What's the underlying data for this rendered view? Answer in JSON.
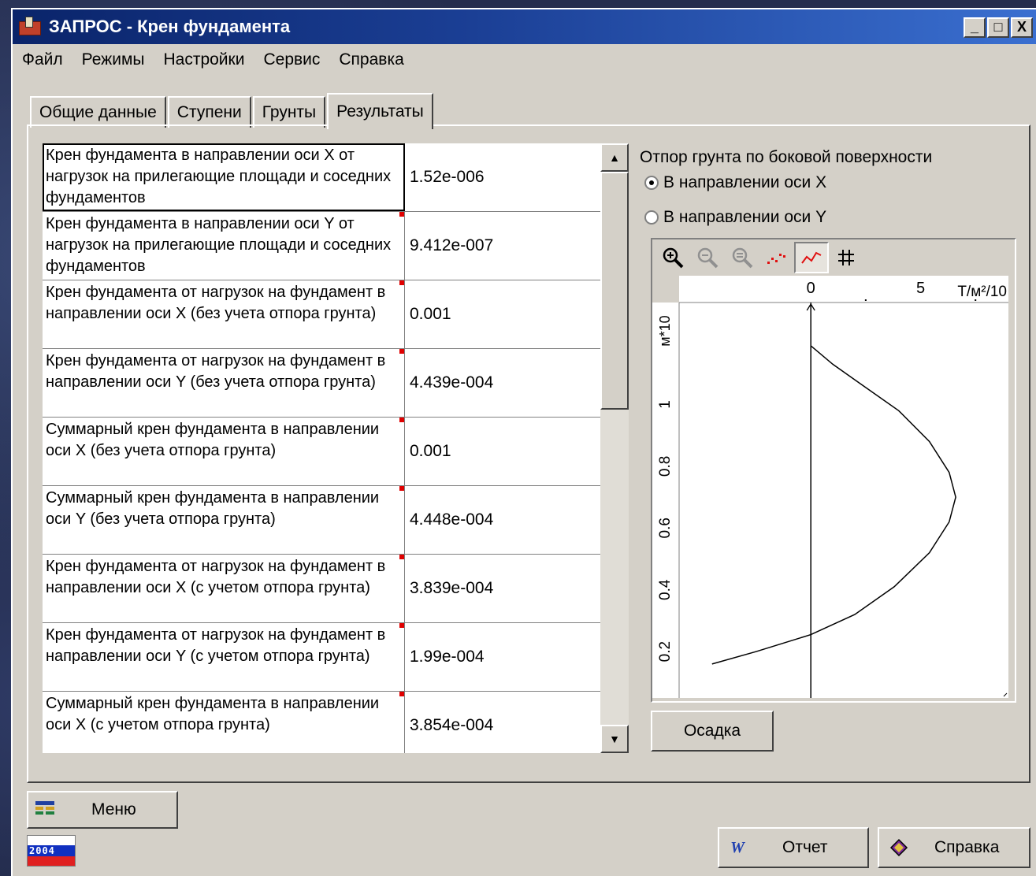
{
  "window": {
    "title": "ЗАПРОС - Крен фундамента",
    "controls": [
      "_",
      "□",
      "X"
    ]
  },
  "menu": [
    "Файл",
    "Режимы",
    "Настройки",
    "Сервис",
    "Справка"
  ],
  "tabs": [
    {
      "label": "Общие данные",
      "active": false
    },
    {
      "label": "Ступени",
      "active": false
    },
    {
      "label": "Грунты",
      "active": false
    },
    {
      "label": "Результаты",
      "active": true
    }
  ],
  "results": [
    {
      "label": "Крен фундамента в направлении оси X от нагрузок на прилегающие площади и соседних фундаментов",
      "value": "1.52e-006"
    },
    {
      "label": "Крен фундамента в направлении оси Y от нагрузок на прилегающие площади и соседних фундаментов",
      "value": "9.412e-007"
    },
    {
      "label": "Крен фундамента от нагрузок на фундамент в направлении оси X  (без учета отпора грунта)",
      "value": "0.001"
    },
    {
      "label": "Крен фундамента от нагрузок на фундамент в направлении оси Y  (без учета отпора грунта)",
      "value": "4.439e-004"
    },
    {
      "label": "Суммарный крен фундамента в направлении оси X  (без учета отпора грунта)",
      "value": "0.001"
    },
    {
      "label": "Суммарный крен фундамента в направлении оси Y  (без учета отпора грунта)",
      "value": "4.448e-004"
    },
    {
      "label": "Крен фундамента от нагрузок на фундамент в направлении оси X  (с учетом отпора грунта)",
      "value": "3.839e-004"
    },
    {
      "label": "Крен фундамента от нагрузок на фундамент в направлении оси Y  (с учетом отпора грунта)",
      "value": "1.99e-004"
    },
    {
      "label": "Суммарный крен фундамента в направлении оси X  (с учетом отпора грунта)",
      "value": "3.854e-004"
    }
  ],
  "right": {
    "title": "Отпор грунта по боковой поверхности",
    "radio_x": "В направлении оси X",
    "radio_y": "В направлении оси Y",
    "selected": "x",
    "settlement_button": "Осадка"
  },
  "chart_toolbar": [
    "zoom-in-icon",
    "zoom-out-icon",
    "zoom-reset-icon",
    "points-icon",
    "line-icon",
    "grid-icon"
  ],
  "chart_data": {
    "type": "line",
    "xlabel": "Т/м²/10",
    "ylabel": "м*10",
    "x_ticks": [
      "0",
      "5"
    ],
    "y_ticks": [
      "0.2",
      "0.4",
      "0.6",
      "0.8",
      "1"
    ],
    "xlim": [
      0,
      9
    ],
    "ylim": [
      0.05,
      1.33
    ],
    "series": [
      {
        "points": [
          [
            -4.5,
            0.16
          ],
          [
            -2.5,
            0.2
          ],
          [
            0,
            0.255
          ],
          [
            2.0,
            0.32
          ],
          [
            3.8,
            0.41
          ],
          [
            5.4,
            0.52
          ],
          [
            6.3,
            0.62
          ],
          [
            6.6,
            0.7
          ],
          [
            6.3,
            0.78
          ],
          [
            5.4,
            0.88
          ],
          [
            4.0,
            0.98
          ],
          [
            2.2,
            1.07
          ],
          [
            1.0,
            1.13
          ],
          [
            0,
            1.19
          ]
        ]
      }
    ]
  },
  "bottom": {
    "menu_button": "Меню",
    "report_button": "Отчет",
    "help_button": "Справка",
    "logo_text": "2004"
  }
}
